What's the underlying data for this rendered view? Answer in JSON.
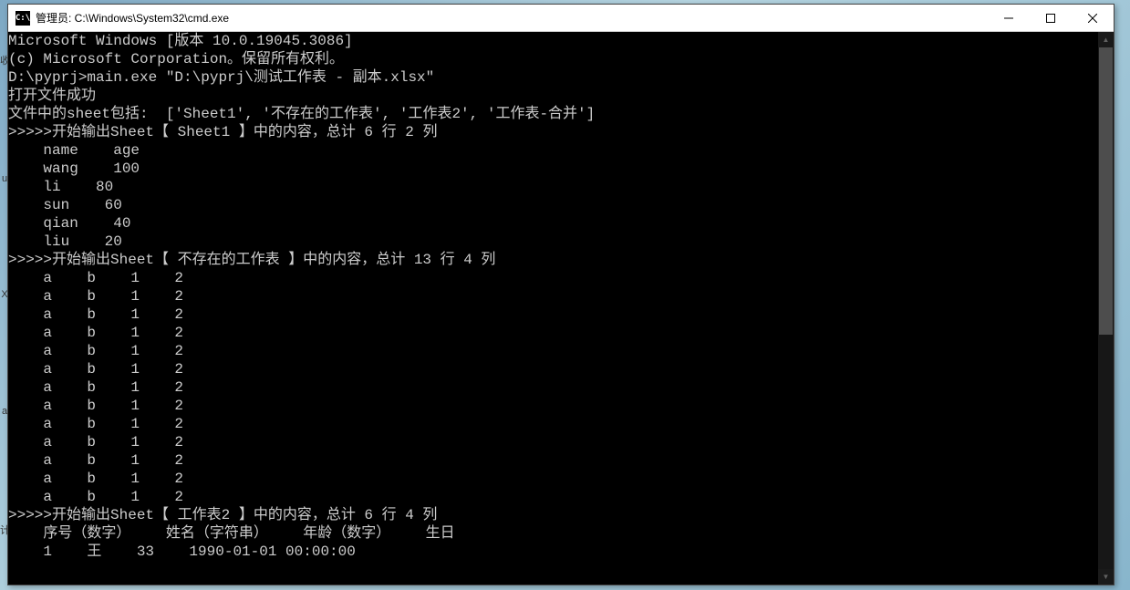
{
  "titlebar": {
    "icon_label": "C:\\",
    "title": "管理员: C:\\Windows\\System32\\cmd.exe"
  },
  "terminal": {
    "lines": {
      "l0": "Microsoft Windows [版本 10.0.19045.3086]",
      "l1": "(c) Microsoft Corporation。保留所有权利。",
      "l2": "",
      "l3": "D:\\pyprj>main.exe \"D:\\pyprj\\测试工作表 - 副本.xlsx\"",
      "l4": "打开文件成功",
      "l5": "文件中的sheet包括:  ['Sheet1', '不存在的工作表', '工作表2', '工作表-合并']",
      "l6": ">>>>>开始输出Sheet【 Sheet1 】中的内容，总计 6 行 2 列",
      "l7": "    name    age",
      "l8": "    wang    100",
      "l9": "    li    80",
      "l10": "    sun    60",
      "l11": "    qian    40",
      "l12": "    liu    20",
      "l13": ">>>>>开始输出Sheet【 不存在的工作表 】中的内容，总计 13 行 4 列",
      "l14": "    a    b    1    2",
      "l15": "    a    b    1    2",
      "l16": "    a    b    1    2",
      "l17": "    a    b    1    2",
      "l18": "    a    b    1    2",
      "l19": "    a    b    1    2",
      "l20": "    a    b    1    2",
      "l21": "    a    b    1    2",
      "l22": "    a    b    1    2",
      "l23": "    a    b    1    2",
      "l24": "    a    b    1    2",
      "l25": "    a    b    1    2",
      "l26": "    a    b    1    2",
      "l27": ">>>>>开始输出Sheet【 工作表2 】中的内容，总计 6 行 4 列",
      "l28": "    序号（数字）    姓名（字符串）    年龄（数字）    生日",
      "l29": "    1    王    33    1990-01-01 00:00:00"
    }
  },
  "desktop": {
    "icon0": "收",
    "icon1": "u",
    "icon2": "X",
    "icon3": "a",
    "icon4": "计"
  }
}
